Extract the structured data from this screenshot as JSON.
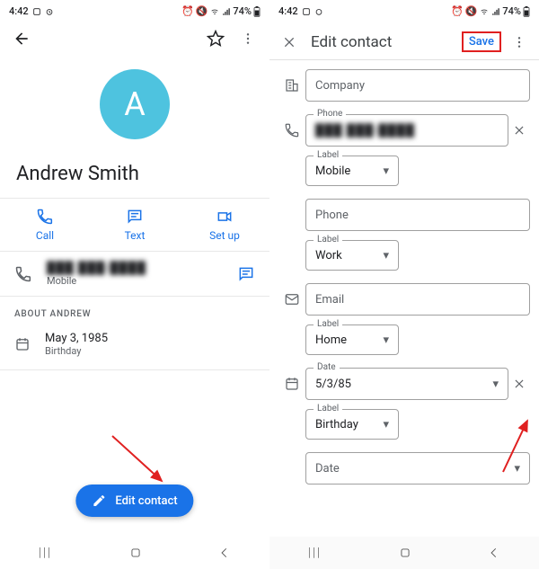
{
  "status": {
    "time": "4:42",
    "battery": "74%"
  },
  "view": {
    "avatar_letter": "A",
    "name": "Andrew Smith",
    "actions": {
      "call": "Call",
      "text": "Text",
      "setup": "Set up"
    },
    "phone": {
      "number": "███ ███-████",
      "label": "Mobile"
    },
    "about_header": "ABOUT ANDREW",
    "birthday": {
      "date": "May 3, 1985",
      "label": "Birthday"
    },
    "fab": "Edit contact"
  },
  "edit": {
    "title": "Edit contact",
    "save": "Save",
    "company": {
      "legend": "",
      "ph": "Company"
    },
    "phone1": {
      "legend": "Phone",
      "value": "███ ███-████",
      "label_legend": "Label",
      "label_value": "Mobile"
    },
    "phone2": {
      "ph": "Phone",
      "label_legend": "Label",
      "label_value": "Work"
    },
    "email": {
      "ph": "Email",
      "label_legend": "Label",
      "label_value": "Home"
    },
    "date1": {
      "legend": "Date",
      "value": "5/3/85",
      "label_legend": "Label",
      "label_value": "Birthday"
    },
    "date2": {
      "ph": "Date"
    }
  },
  "nav": {
    "recent": "|||",
    "home": "◯",
    "back": "‹"
  }
}
